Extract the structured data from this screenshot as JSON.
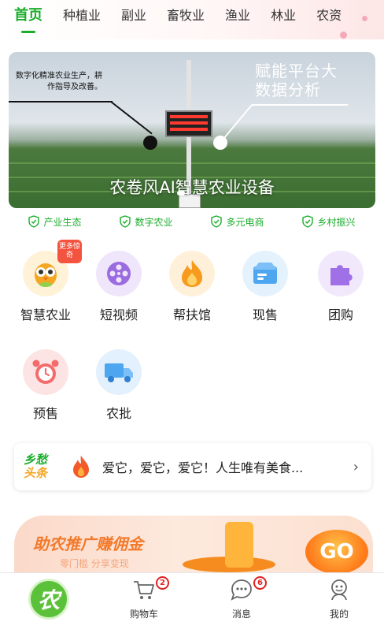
{
  "top_tabs": [
    "首页",
    "种植业",
    "副业",
    "畜牧业",
    "渔业",
    "林业",
    "农资"
  ],
  "banner": {
    "left_text": "数字化精准农业生产，耕作指导及改善。",
    "right_text": "赋能平台大数据分析",
    "caption": "农卷风AI智慧农业设备"
  },
  "features": [
    "产业生态",
    "数字农业",
    "多元电商",
    "乡村振兴"
  ],
  "grid": [
    {
      "label": "智慧农业",
      "icon": "owl-icon",
      "badge": "更多惊奇"
    },
    {
      "label": "短视频",
      "icon": "film-reel-icon"
    },
    {
      "label": "帮扶馆",
      "icon": "flame-icon"
    },
    {
      "label": "现售",
      "icon": "box-icon"
    },
    {
      "label": "团购",
      "icon": "puzzle-icon"
    },
    {
      "label": "预售",
      "icon": "alarm-clock-icon"
    },
    {
      "label": "农批",
      "icon": "truck-icon"
    }
  ],
  "ticker": {
    "logo_line1": "乡愁",
    "logo_line2": "头条",
    "text": "爱它，爱它，爱它！人生唯有美食...",
    "chevron": "›"
  },
  "promo": {
    "title": "助农推广赚佣金",
    "subtitle": "零门槛 分享变现",
    "go": "GO"
  },
  "tabbar": {
    "home_glyph": "农",
    "cart_label": "购物车",
    "cart_count": "2",
    "messages_label": "消息",
    "messages_count": "6",
    "profile_label": "我的"
  },
  "colors": {
    "accent": "#1aad2b",
    "promo_orange": "#f27a2c",
    "badge_red": "#e02222"
  }
}
